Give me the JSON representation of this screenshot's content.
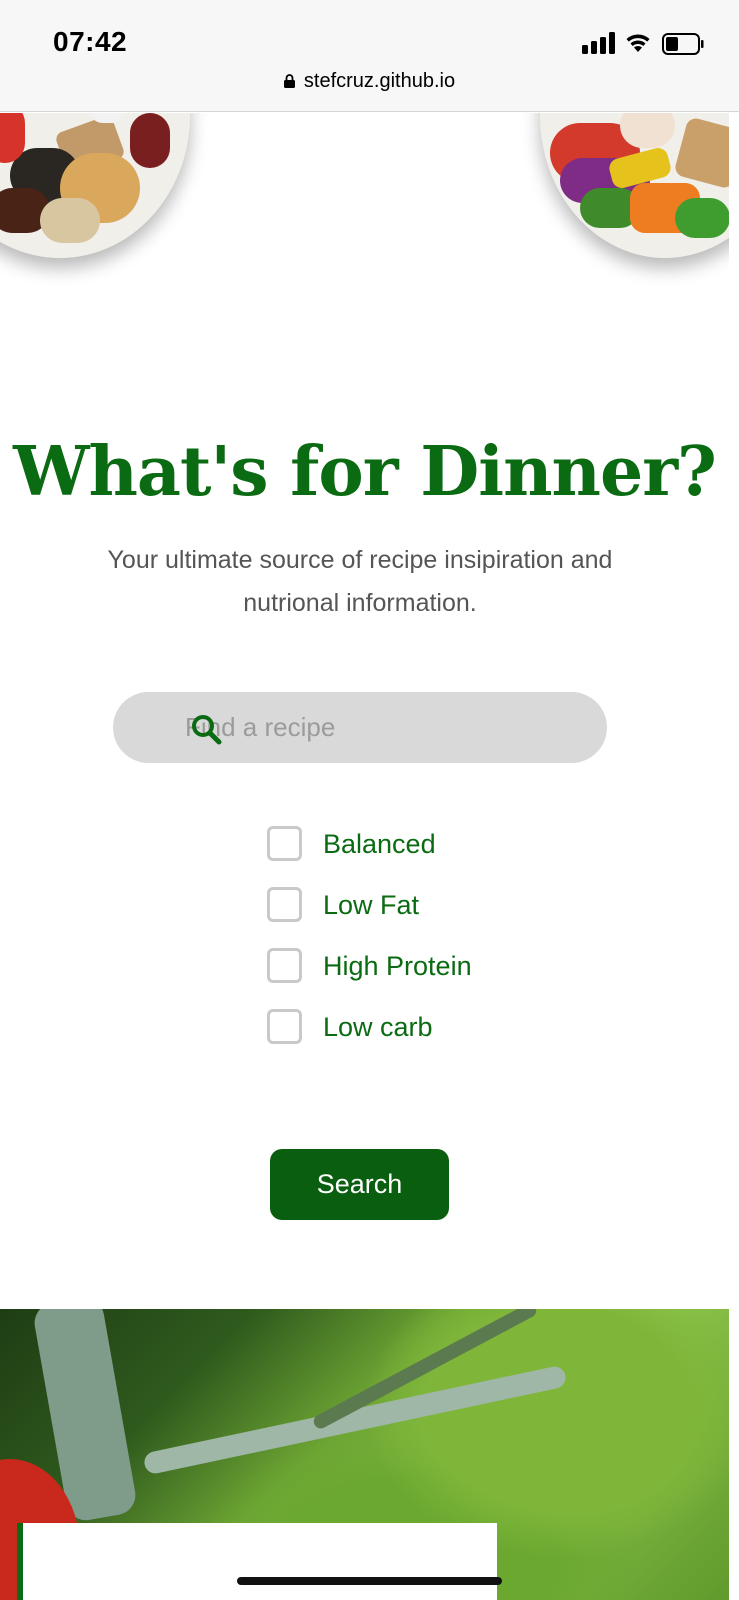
{
  "status_bar": {
    "time": "07:42",
    "url": "stefcruz.github.io",
    "icons": [
      "signal-icon",
      "wifi-icon",
      "battery-icon",
      "lock-icon"
    ]
  },
  "hero": {
    "title": "What's for Dinner?",
    "subtitle": "Your ultimate source of recipe insipiration and nutrional information."
  },
  "search": {
    "placeholder": "Find a recipe",
    "value": "",
    "icon": "search-icon",
    "button_label": "Search"
  },
  "diet_options": [
    {
      "label": "Balanced",
      "checked": false
    },
    {
      "label": "Low Fat",
      "checked": false
    },
    {
      "label": "High Protein",
      "checked": false
    },
    {
      "label": "Low carb",
      "checked": false
    }
  ],
  "colors": {
    "brand_green": "#0b6b12",
    "button_green": "#0a5e0f",
    "input_background": "#d9d9d9"
  }
}
